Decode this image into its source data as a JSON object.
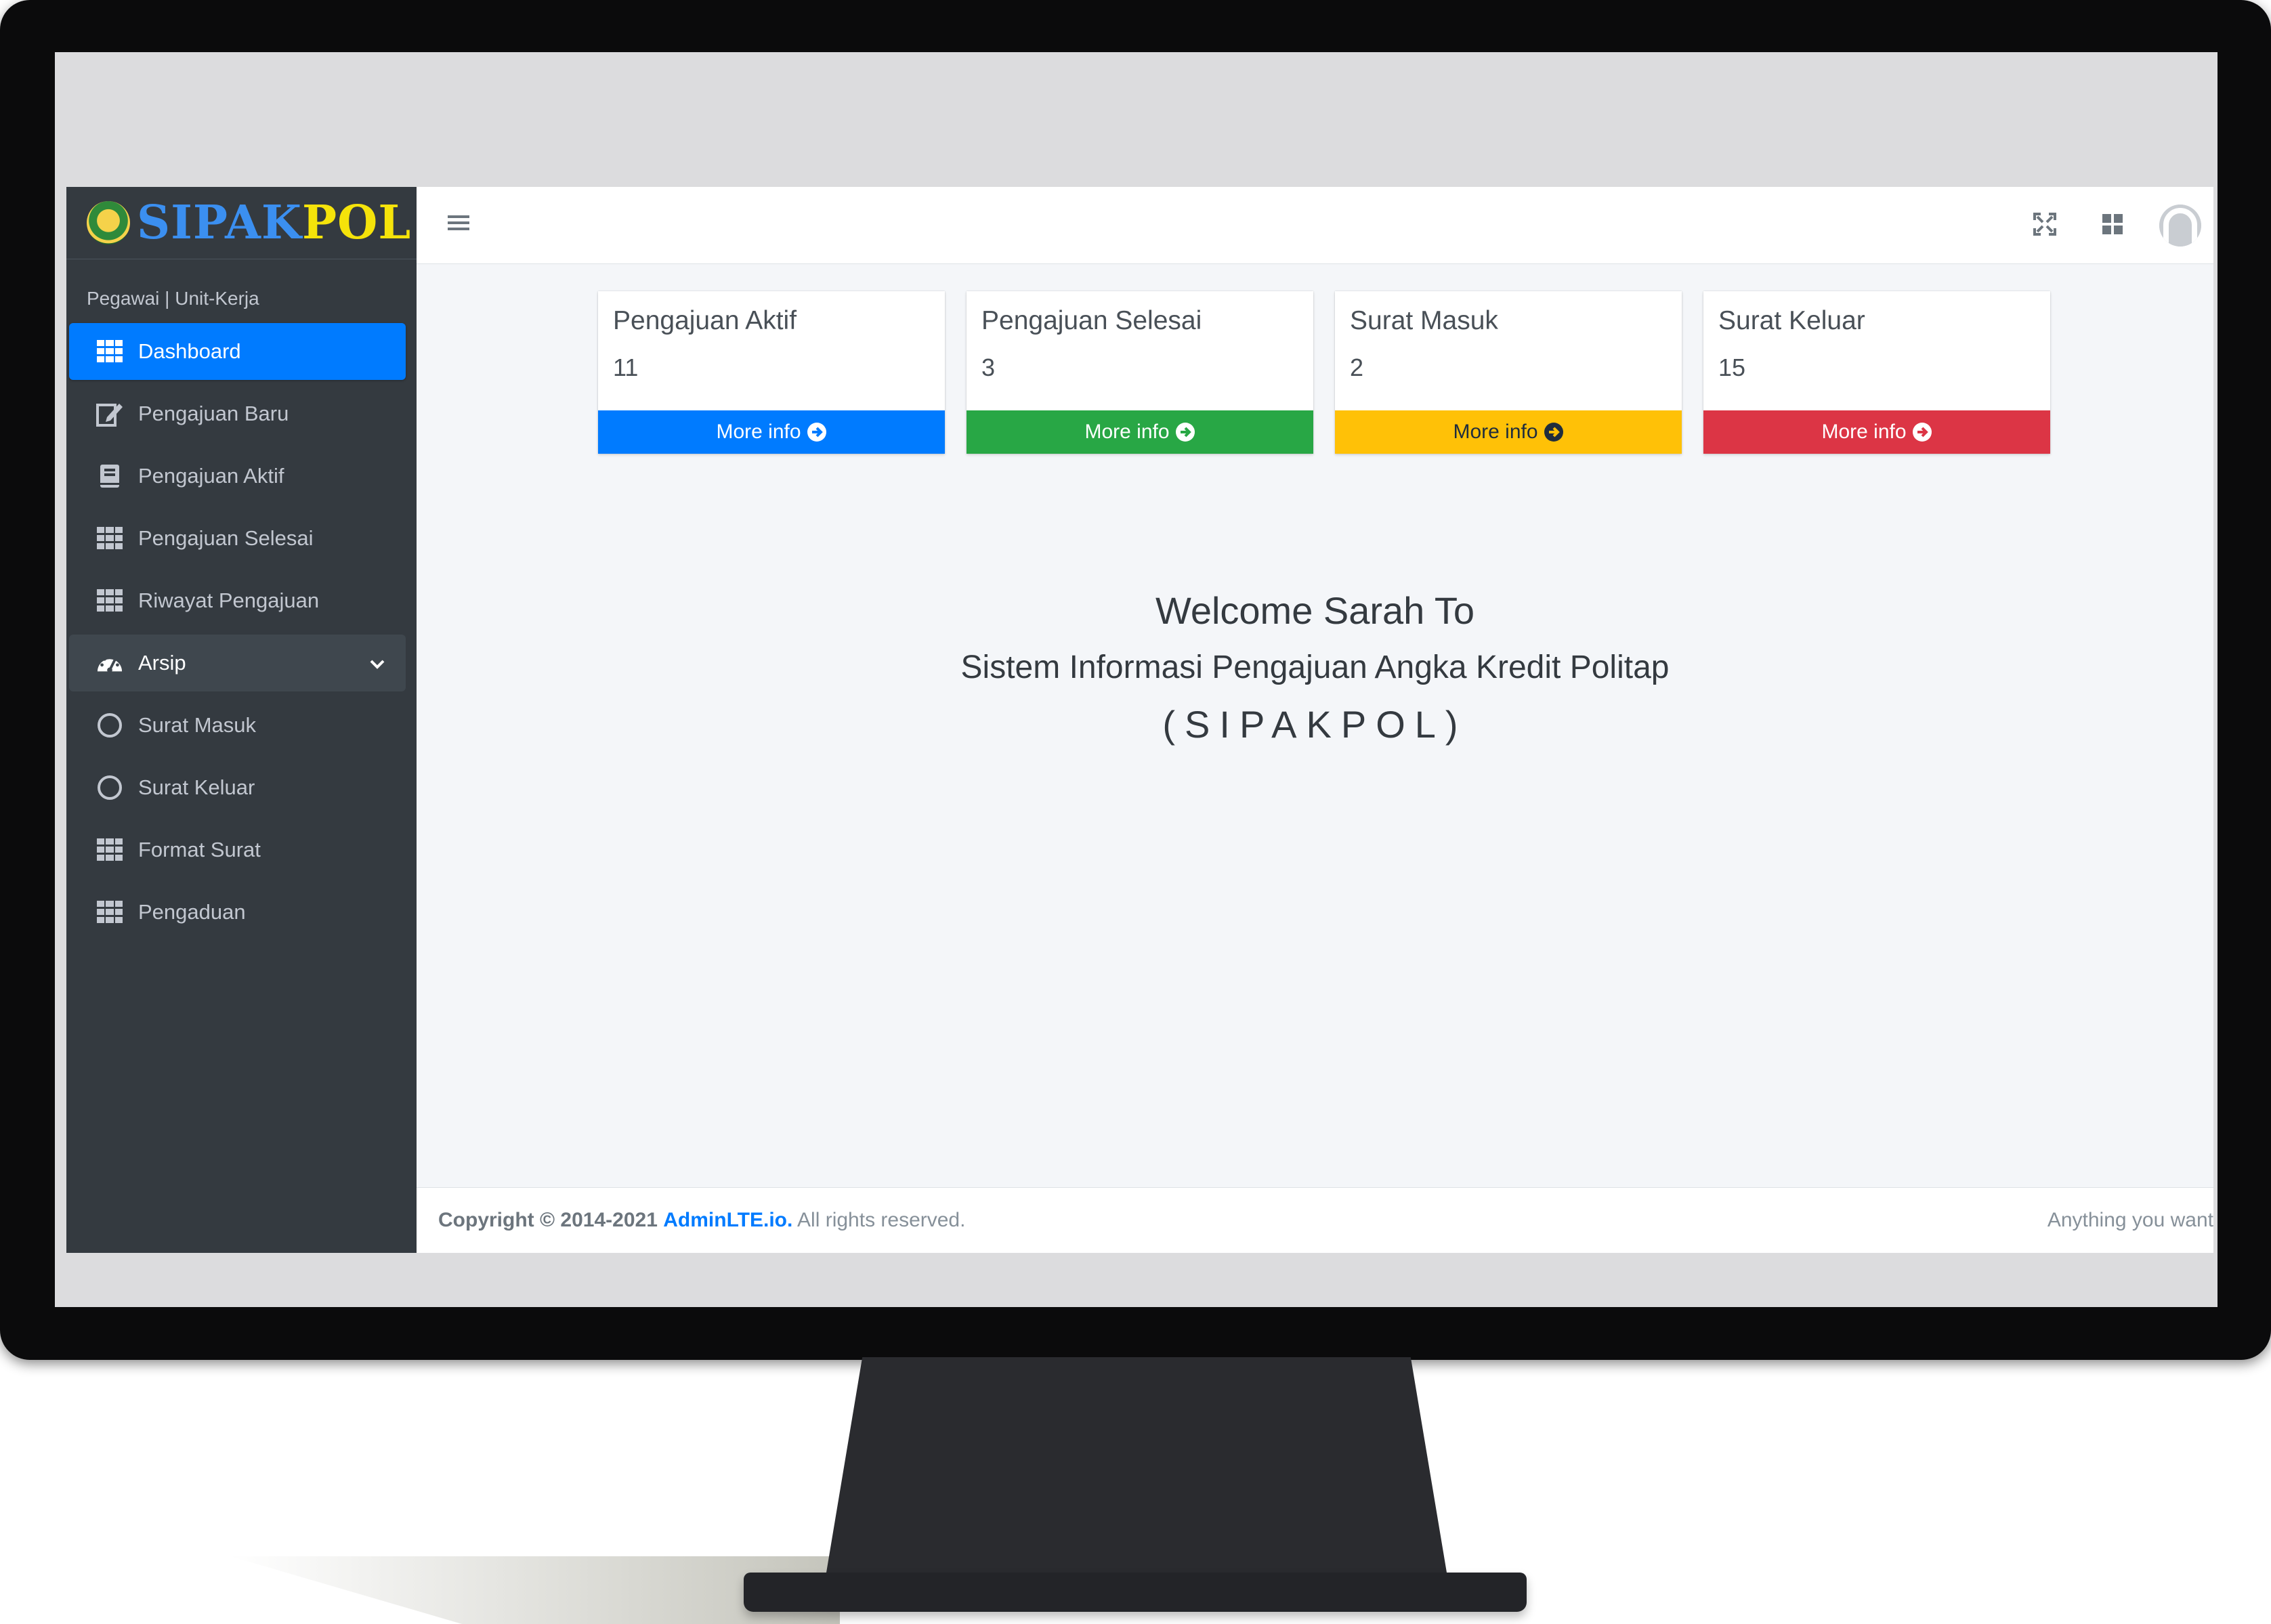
{
  "brand": {
    "part1": "SIPAK",
    "part2": "POL"
  },
  "sidebar": {
    "user_label": "Pegawai | Unit-Kerja",
    "items": [
      {
        "label": "Dashboard",
        "icon": "table-icon"
      },
      {
        "label": "Pengajuan Baru",
        "icon": "edit-icon"
      },
      {
        "label": "Pengajuan Aktif",
        "icon": "book-icon"
      },
      {
        "label": "Pengajuan Selesai",
        "icon": "table-icon"
      },
      {
        "label": "Riwayat Pengajuan",
        "icon": "table-icon"
      },
      {
        "label": "Arsip",
        "icon": "tachometer-icon"
      },
      {
        "label": "Surat Masuk",
        "icon": "circle-icon"
      },
      {
        "label": "Surat Keluar",
        "icon": "circle-icon"
      },
      {
        "label": "Format Surat",
        "icon": "table-icon"
      },
      {
        "label": "Pengaduan",
        "icon": "table-icon"
      }
    ]
  },
  "cards": [
    {
      "title": "Pengajuan Aktif",
      "value": "11",
      "link": "More info",
      "color": "#007bff"
    },
    {
      "title": "Pengajuan Selesai",
      "value": "3",
      "link": "More info",
      "color": "#28a745"
    },
    {
      "title": "Surat Masuk",
      "value": "2",
      "link": "More info",
      "color": "#ffc107"
    },
    {
      "title": "Surat Keluar",
      "value": "15",
      "link": "More info",
      "color": "#dc3545"
    }
  ],
  "welcome": {
    "line1": "Welcome Sarah To",
    "line2": "Sistem Informasi Pengajuan Angka Kredit Politap",
    "line3": "(SIPAKPOL)"
  },
  "footer": {
    "copyright": "Copyright © 2014-2021",
    "brand": "AdminLTE.io.",
    "rights": "All rights reserved.",
    "right_text": "Anything you want"
  },
  "colors": {
    "sidebar_bg": "#343a40",
    "primary": "#007bff",
    "content_bg": "#f4f6f9"
  }
}
